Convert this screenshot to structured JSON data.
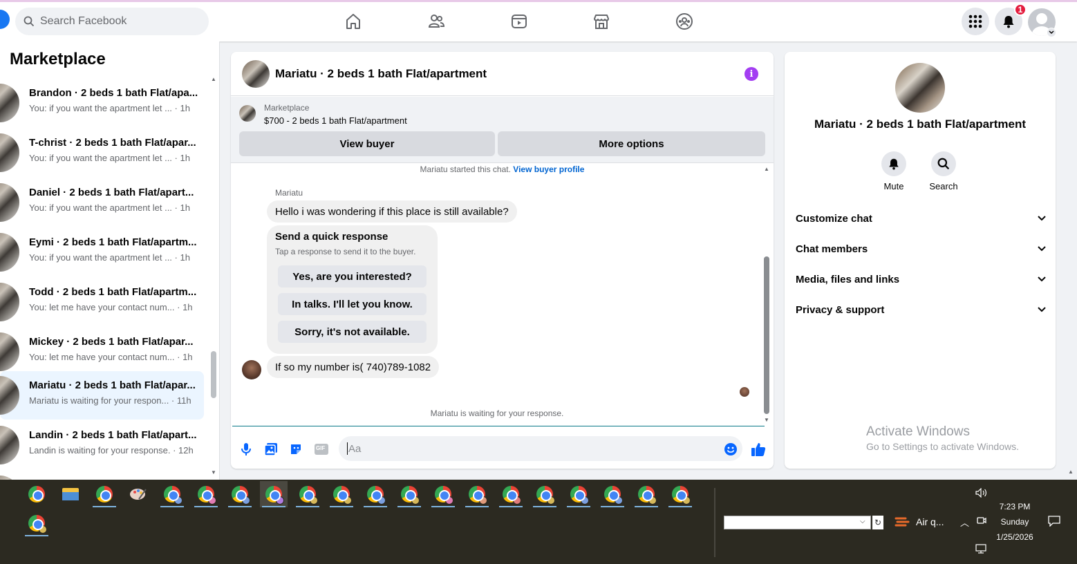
{
  "topbar": {
    "search_placeholder": "Search Facebook",
    "notification_count": "1",
    "icons": [
      "home-icon",
      "friends-icon",
      "video-icon",
      "marketplace-icon",
      "groups-icon",
      "menu-grid-icon",
      "bell-icon",
      "profile-avatar"
    ]
  },
  "sidebar": {
    "title": "Marketplace",
    "conversations": [
      {
        "name": "Brandon · 2 beds 1 bath Flat/apa...",
        "preview": "You: if you want the apartment let ... · 1h"
      },
      {
        "name": "T-christ · 2 beds 1 bath Flat/apar...",
        "preview": "You: if you want the apartment let ... · 1h"
      },
      {
        "name": "Daniel · 2 beds 1 bath Flat/apart...",
        "preview": "You: if you want the apartment let ... · 1h"
      },
      {
        "name": "Eymi · 2 beds 1 bath Flat/apartm...",
        "preview": "You: if you want the apartment let ... · 1h"
      },
      {
        "name": "Todd · 2 beds 1 bath Flat/apartm...",
        "preview": "You: let me have your contact num... · 1h"
      },
      {
        "name": "Mickey · 2 beds 1 bath Flat/apar...",
        "preview": "You: let me have your contact num... · 1h"
      },
      {
        "name": "Mariatu · 2 beds 1 bath Flat/apar...",
        "preview": "Mariatu is waiting for your respon... · 11h"
      },
      {
        "name": "Landin · 2 beds 1 bath Flat/apart...",
        "preview": "Landin is waiting for your response. · 12h"
      }
    ]
  },
  "chat": {
    "title": "Mariatu · 2 beds 1 bath Flat/apartment",
    "marketplace_label": "Marketplace",
    "listing": "$700 - 2 beds 1 bath Flat/apartment",
    "view_buyer": "View buyer",
    "more_options": "More options",
    "started_text": "Mariatu started this chat.",
    "buyer_profile_link": "View buyer profile",
    "sender": "Mariatu",
    "message1": "Hello i was wondering if this place is still available?",
    "quick_title": "Send a quick response",
    "quick_sub": "Tap a response to send it to the buyer.",
    "quick_options": [
      "Yes, are you interested?",
      "In talks. I'll let you know.",
      "Sorry, it's not available."
    ],
    "message2": "If so my number is( 740)789-1082",
    "waiting": "Mariatu is waiting for your response.",
    "composer_placeholder": "Aa",
    "gif_label": "GIF"
  },
  "details": {
    "title": "Mariatu · 2 beds 1 bath Flat/apartment",
    "mute": "Mute",
    "search": "Search",
    "rows": [
      "Customize chat",
      "Chat members",
      "Media, files and links",
      "Privacy & support"
    ]
  },
  "watermark": {
    "line1": "Activate Windows",
    "line2": "Go to Settings to activate Windows."
  },
  "taskbar": {
    "air_quality": "Air q...",
    "time": "7:23 PM",
    "day": "Sunday",
    "date": "1/25/2026"
  },
  "colors": {
    "accent": "#1877f2",
    "active_conv": "#ebf5ff",
    "info": "#a33ef2",
    "badge": "#e41e3f",
    "taskbar": "#2c2a21"
  }
}
